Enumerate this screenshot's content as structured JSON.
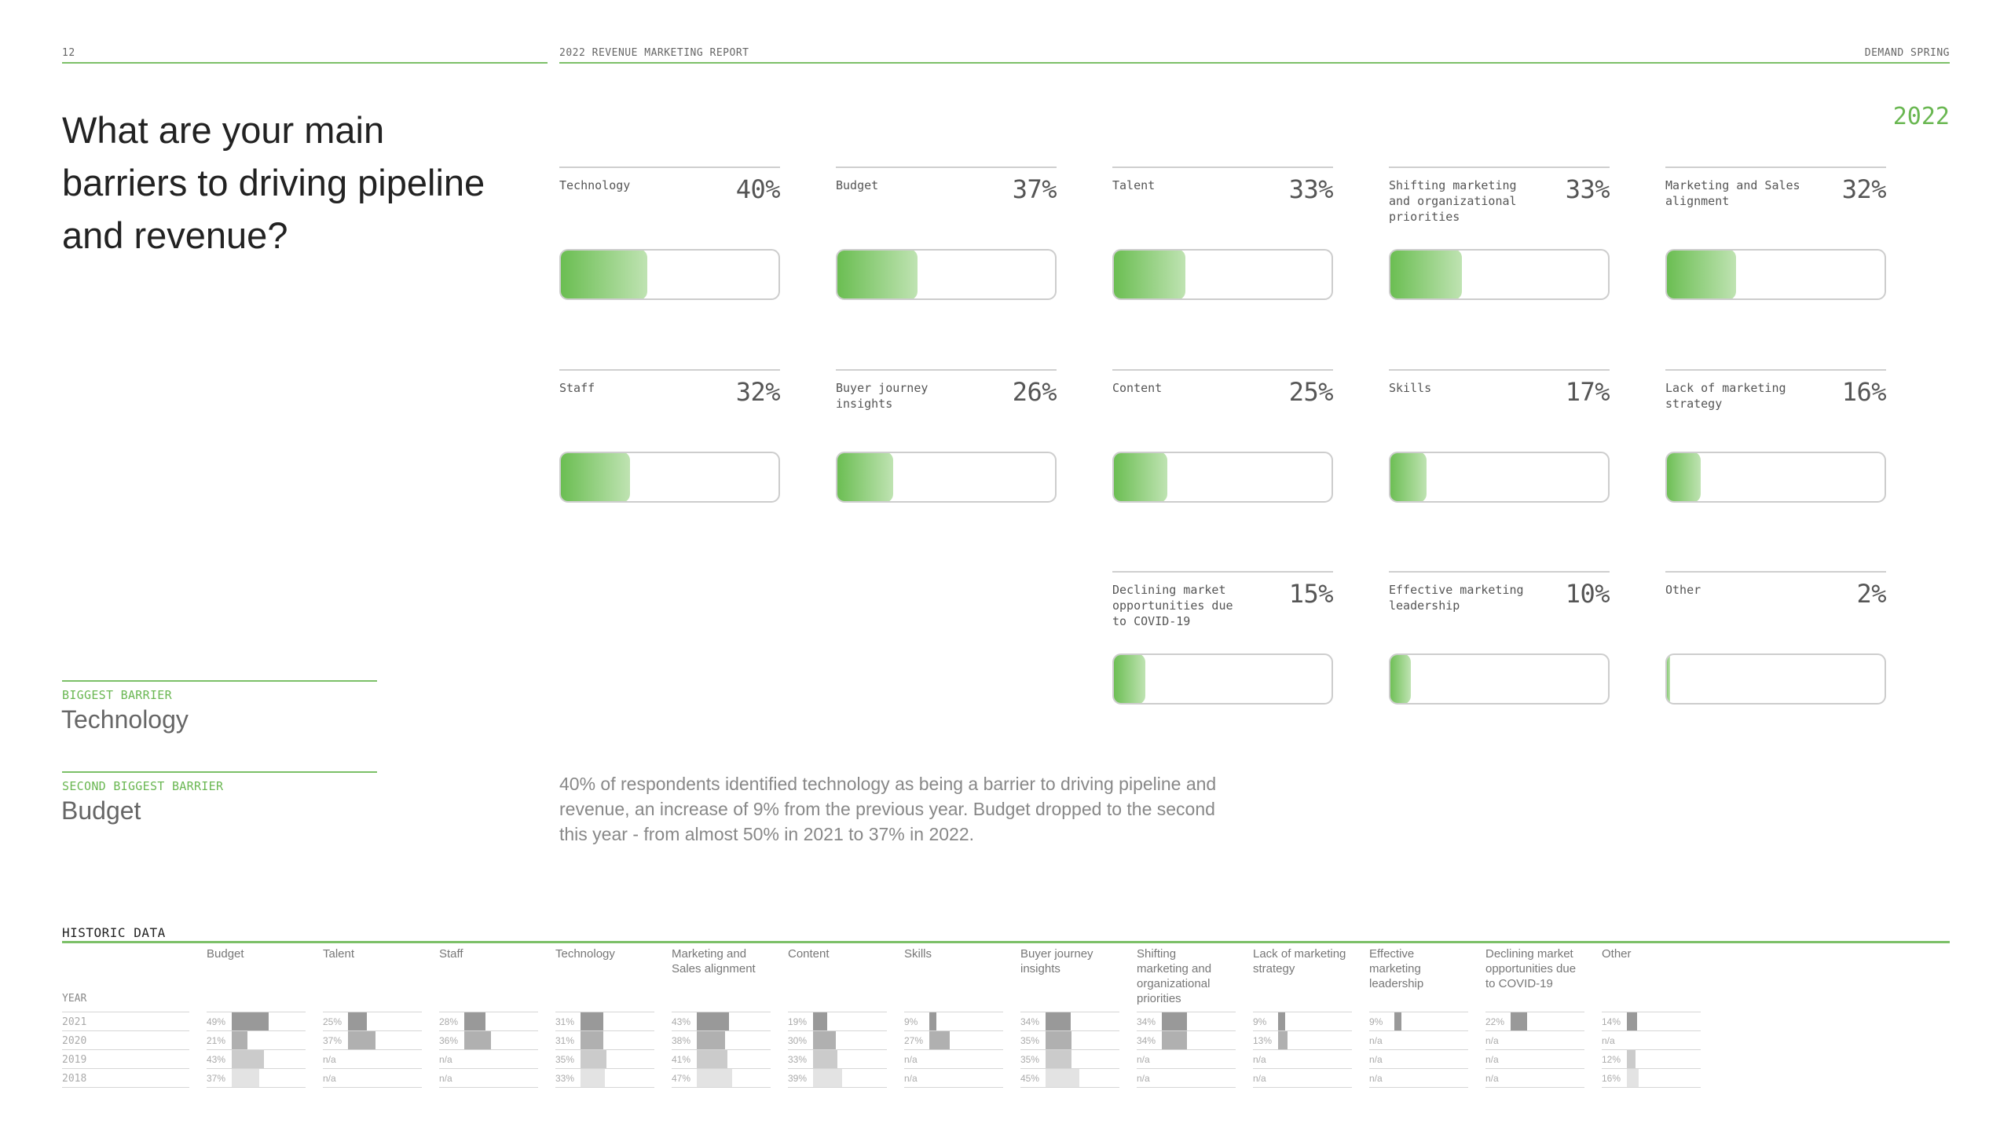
{
  "header": {
    "page_number": "12",
    "report_title": "2022 REVENUE MARKETING REPORT",
    "brand": "DEMAND SPRING"
  },
  "title": "What are your main barriers to driving pipeline and revenue?",
  "year_tag": "2022",
  "colors": {
    "accent_green": "#6ab752",
    "bar_gradient_start": "#69bd50",
    "bar_gradient_end": "#bfe3b2",
    "hist_2021": "#999999",
    "hist_2020": "#b0b0b0",
    "hist_2019": "#cbcbcb",
    "hist_2018": "#e3e3e3"
  },
  "barriers": [
    {
      "label": "Technology",
      "pct_text": "40%",
      "value": 40
    },
    {
      "label": "Budget",
      "pct_text": "37%",
      "value": 37
    },
    {
      "label": "Talent",
      "pct_text": "33%",
      "value": 33
    },
    {
      "label": "Shifting marketing and organizational priorities",
      "pct_text": "33%",
      "value": 33
    },
    {
      "label": "Marketing and Sales alignment",
      "pct_text": "32%",
      "value": 32
    },
    {
      "label": "Staff",
      "pct_text": "32%",
      "value": 32
    },
    {
      "label": "Buyer journey insights",
      "pct_text": "26%",
      "value": 26
    },
    {
      "label": "Content",
      "pct_text": "25%",
      "value": 25
    },
    {
      "label": "Skills",
      "pct_text": "17%",
      "value": 17
    },
    {
      "label": "Lack of marketing strategy",
      "pct_text": "16%",
      "value": 16
    },
    {
      "label": "Declining market opportunities due to COVID-19",
      "pct_text": "15%",
      "value": 15
    },
    {
      "label": "Effective marketing leadership",
      "pct_text": "10%",
      "value": 10
    },
    {
      "label": "Other",
      "pct_text": "2%",
      "value": 2
    }
  ],
  "summary": {
    "biggest_label": "BIGGEST BARRIER",
    "biggest_value": "Technology",
    "second_label": "SECOND BIGGEST BARRIER",
    "second_value": "Budget"
  },
  "paragraph": "40% of respondents identified technology as being a barrier to driving pipeline and revenue, an increase of 9% from the previous year. Budget dropped to the second this year - from almost 50% in 2021 to 37% in 2022.",
  "historic": {
    "title": "HISTORIC DATA",
    "year_label": "YEAR",
    "years": [
      "2021",
      "2020",
      "2019",
      "2018"
    ],
    "columns": [
      {
        "label": "Budget",
        "values": [
          "49%",
          "21%",
          "43%",
          "37%"
        ]
      },
      {
        "label": "Talent",
        "values": [
          "25%",
          "37%",
          "n/a",
          "n/a"
        ]
      },
      {
        "label": "Staff",
        "values": [
          "28%",
          "36%",
          "n/a",
          "n/a"
        ]
      },
      {
        "label": "Technology",
        "values": [
          "31%",
          "31%",
          "35%",
          "33%"
        ]
      },
      {
        "label": "Marketing and Sales alignment",
        "values": [
          "43%",
          "38%",
          "41%",
          "47%"
        ]
      },
      {
        "label": "Content",
        "values": [
          "19%",
          "30%",
          "33%",
          "39%"
        ]
      },
      {
        "label": "Skills",
        "values": [
          "9%",
          "27%",
          "n/a",
          "n/a"
        ]
      },
      {
        "label": "Buyer journey insights",
        "values": [
          "34%",
          "35%",
          "35%",
          "45%"
        ]
      },
      {
        "label": "Shifting marketing and organizational priorities",
        "values": [
          "34%",
          "34%",
          "n/a",
          "n/a"
        ]
      },
      {
        "label": "Lack of marketing strategy",
        "values": [
          "9%",
          "13%",
          "n/a",
          "n/a"
        ]
      },
      {
        "label": "Effective marketing leadership",
        "values": [
          "9%",
          "n/a",
          "n/a",
          "n/a"
        ]
      },
      {
        "label": "Declining market opportunities due to COVID-19",
        "values": [
          "22%",
          "n/a",
          "n/a",
          "n/a"
        ]
      },
      {
        "label": "Other",
        "values": [
          "14%",
          "n/a",
          "12%",
          "16%"
        ]
      }
    ]
  }
}
